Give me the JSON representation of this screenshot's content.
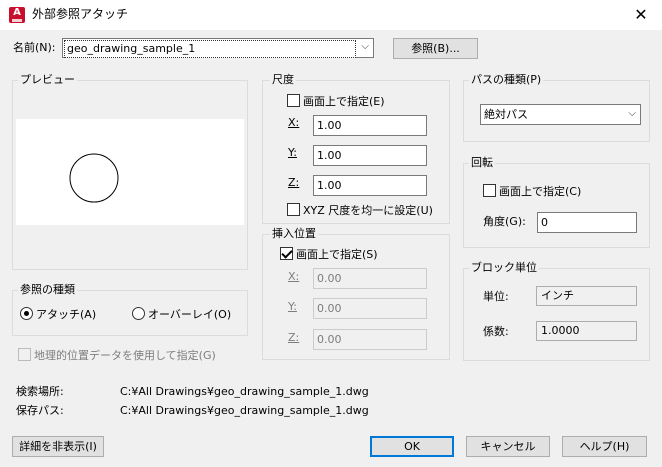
{
  "window": {
    "title": "外部参照アタッチ",
    "close_glyph": "✕",
    "app_icon_letter": "A"
  },
  "name_row": {
    "label": "名前(N):",
    "value": "geo_drawing_sample_1",
    "browse_button": "参照(B)..."
  },
  "preview": {
    "label": "プレビュー"
  },
  "scale": {
    "legend": "尺度",
    "specify_onscreen": "画面上で指定(E)",
    "specify_onscreen_checked": false,
    "x_label": "X:",
    "x_value": "1.00",
    "y_label": "Y:",
    "y_value": "1.00",
    "z_label": "Z:",
    "z_value": "1.00",
    "uniform_scale": "XYZ 尺度を均一に設定(U)",
    "uniform_scale_checked": false
  },
  "insertion": {
    "legend": "挿入位置",
    "specify_onscreen": "画面上で指定(S)",
    "specify_onscreen_checked": true,
    "x_label": "X:",
    "x_value": "0.00",
    "y_label": "Y:",
    "y_value": "0.00",
    "z_label": "Z:",
    "z_value": "0.00"
  },
  "path_type": {
    "legend": "パスの種類(P)",
    "value": "絶対パス"
  },
  "rotation": {
    "legend": "回転",
    "specify_onscreen": "画面上で指定(C)",
    "specify_onscreen_checked": false,
    "angle_label": "角度(G):",
    "angle_value": "0"
  },
  "block_unit": {
    "legend": "ブロック単位",
    "unit_label": "単位:",
    "unit_value": "インチ",
    "factor_label": "係数:",
    "factor_value": "1.0000"
  },
  "reference_type": {
    "legend": "参照の種類",
    "attach": "アタッチ(A)",
    "overlay": "オーバーレイ(O)",
    "selected": "attach"
  },
  "geo": {
    "label": "地理的位置データを使用して指定(G)",
    "checked": false
  },
  "paths": {
    "found_in_label": "検索場所:",
    "found_in_value": "C:¥All Drawings¥geo_drawing_sample_1.dwg",
    "saved_path_label": "保存パス:",
    "saved_path_value": "C:¥All Drawings¥geo_drawing_sample_1.dwg"
  },
  "buttons": {
    "hide_details": "詳細を非表示(I)",
    "ok": "OK",
    "cancel": "キャンセル",
    "help": "ヘルプ(H)"
  }
}
